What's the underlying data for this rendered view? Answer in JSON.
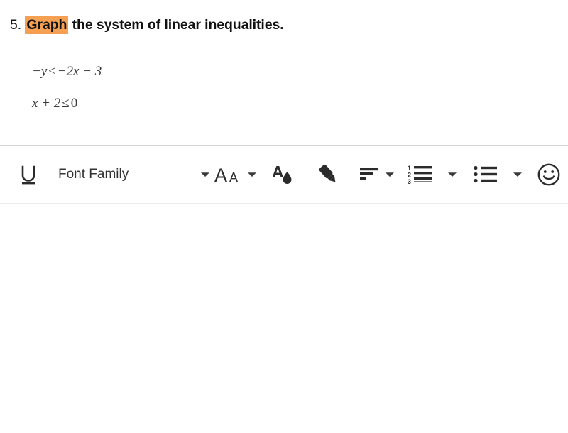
{
  "question": {
    "number": "5.",
    "highlighted_word": "Graph",
    "rest": " the system of linear inequalities.",
    "highlight_color": "#f5a052"
  },
  "math": {
    "lines": [
      {
        "full": "−y ≤ −2x − 3",
        "parts": {
          "lhs": "−y",
          "rel": "≤",
          "rhs": "−2x − 3"
        }
      },
      {
        "full": "x + 2 ≤ 0",
        "parts": {
          "lhs": "x + 2",
          "rel": "≤",
          "rhs": "0"
        }
      }
    ]
  },
  "toolbar": {
    "underline": {
      "label": "U",
      "icon": "underline-icon"
    },
    "font_family": {
      "label": "Font Family",
      "icon": "font-family-label"
    },
    "font_family_caret": {
      "icon": "chevron-down-icon"
    },
    "font_size": {
      "label": "Aa",
      "icon": "font-size-icon"
    },
    "font_size_caret": {
      "icon": "chevron-down-icon"
    },
    "text_color": {
      "icon": "text-color-icon"
    },
    "highlighter": {
      "icon": "highlighter-icon"
    },
    "align": {
      "icon": "text-align-icon"
    },
    "align_caret": {
      "icon": "chevron-down-icon"
    },
    "numbered_list": {
      "icon": "numbered-list-icon",
      "markers": [
        "1",
        "2",
        "3"
      ]
    },
    "numbered_list_caret": {
      "icon": "chevron-down-icon"
    },
    "bulleted_list": {
      "icon": "bulleted-list-icon"
    },
    "bulleted_list_caret": {
      "icon": "chevron-down-icon"
    },
    "emoji": {
      "icon": "smiley-icon"
    }
  },
  "colors": {
    "icon": "#2b2b2b",
    "text": "#333333",
    "divider_top": "#d4d4d4",
    "divider_bottom": "#ececec",
    "highlight": "#f5a052",
    "page_background": "#ffffff"
  }
}
